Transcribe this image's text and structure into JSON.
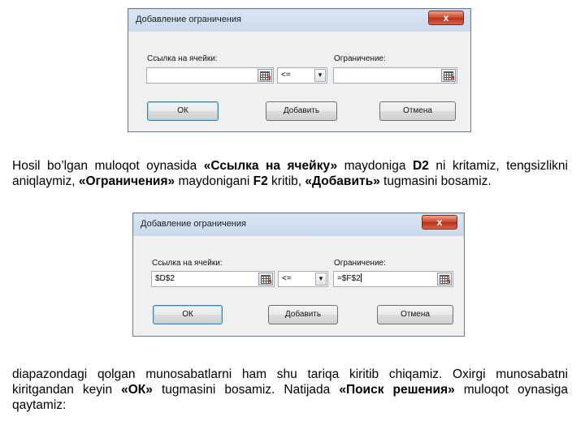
{
  "dialog1": {
    "title": "Добавление ограничения",
    "close_glyph": "x",
    "cell_ref_label": "Ссылка на ячейки:",
    "cell_ref_value": "",
    "operator": "<=",
    "constraint_label": "Ограничение:",
    "constraint_value": "",
    "ok_label": "ОК",
    "add_label": "Добавить",
    "cancel_label": "Отмена"
  },
  "dialog2": {
    "title": "Добавление ограничения",
    "close_glyph": "x",
    "cell_ref_label": "Ссылка на ячейки:",
    "cell_ref_value": "$D$2",
    "operator": "<=",
    "constraint_label": "Ограничение:",
    "constraint_value": "=$F$2",
    "ok_label": "ОК",
    "add_label": "Добавить",
    "cancel_label": "Отмена"
  },
  "paragraph1": {
    "t1": "Hosil bo’lgan muloqot oynasida ",
    "b1": "«Ссылка на ячейку»",
    "t2": " maydoniga  ",
    "b2": "D2",
    "t3": " ni kritamiz, tengsizlikni aniqlaymiz, ",
    "b3": "«Ограничения»",
    "t4": " maydonigani ",
    "b4": "F2",
    "t5": " kritib, ",
    "b5": "«Добавить»",
    "t6": " tugmasini bosamiz."
  },
  "paragraph2": {
    "t1": " diapazondagi qolgan munosabatlarni ham shu tariqa kiritib chiqamiz. Oxirgi munosabatni kiritgandan keyin ",
    "b1": "«ОК»",
    "t2": " tugmasini bosamiz.  Natijada ",
    "b2": "«Поиск решения»",
    "t3": " muloqot oynasiga qaytamiz:"
  },
  "icons": {
    "ref_button": "range-select-icon",
    "dropdown": "chevron-down-icon",
    "close": "close-icon"
  },
  "colors": {
    "close_button": "#c8442a",
    "default_button_border": "#3c7fb1",
    "titlebar": "#c9d9ec"
  }
}
